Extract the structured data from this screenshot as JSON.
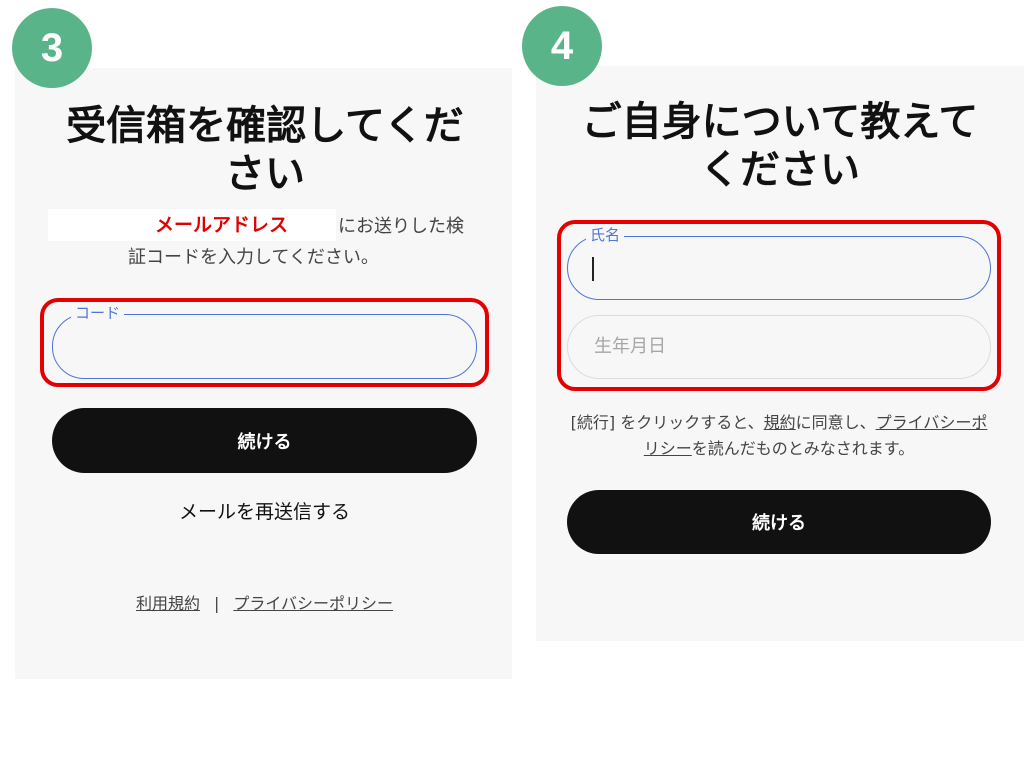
{
  "step3": {
    "badge": "3",
    "title_line1": "受信箱を確認してくだ",
    "title_line2": "さい",
    "email_placeholder": "メールアドレス",
    "sub_a": "にお送りした検",
    "sub_b": "証コードを入力してください。",
    "code_label": "コード",
    "continue_label": "続ける",
    "resend_label": "メールを再送信する",
    "terms_link": "利用規約",
    "separator": "|",
    "privacy_link": "プライバシーポリシー"
  },
  "step4": {
    "badge": "4",
    "title_line1": "ご自身について教えて",
    "title_line2": "ください",
    "name_label": "氏名",
    "dob_placeholder": "生年月日",
    "agree_pre": "[続行] をクリックすると、",
    "agree_terms": "規約",
    "agree_mid": "に同意し、",
    "agree_privacy": "プライバシーポリシー",
    "agree_post": "を読んだものとみなされます。",
    "continue_label": "続ける"
  },
  "colors": {
    "badge": "#5ab489",
    "highlight_red": "#e40000",
    "focus_blue": "#4f76d6",
    "button_black": "#111111"
  }
}
